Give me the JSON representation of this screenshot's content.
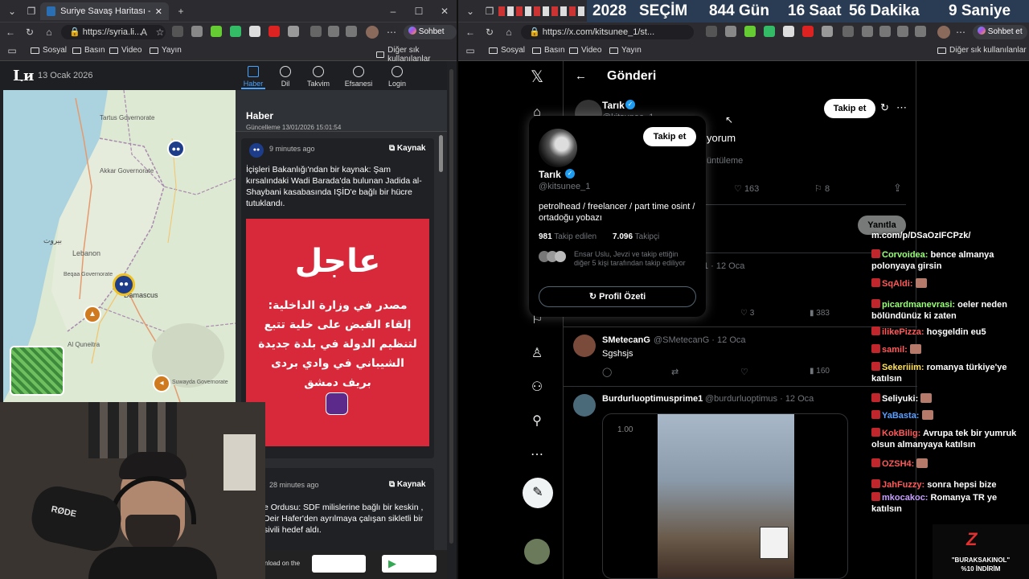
{
  "left_browser": {
    "tab_title": "Suriye Savaş Haritası - Son Dakika",
    "url": "https://syria.li...",
    "favorites": [
      "Sosyal",
      "Basın",
      "Video",
      "Yayın"
    ],
    "other_favorites": "Diğer sık kullanılanlar",
    "copilot": "Sohbet et"
  },
  "liveuamap": {
    "date": "13 Ocak 2026",
    "nav": [
      "Haber",
      "Dil",
      "Takvim",
      "Efsanesi",
      "Login"
    ],
    "panel_title": "Haber",
    "updated": "Güncelleme 13/01/2026 15:01:54",
    "item1_time": "9 minutes ago",
    "item1_source": "Kaynak",
    "item1_text": "İçişleri Bakanlığı'ndan bir kaynak: Şam kırsalındaki Wadi Barada'da bulunan Jadida al-Shaybani kasabasında IŞİD'e bağlı bir hücre tutuklandı.",
    "image_headline": "عاجل",
    "image_body": "مصدر في وزارة الداخلية: إلقاء القبض على خلية تتبع لتنظيم الدولة في بلدة جديدة الشيباني في وادي بردى بريف دمشق",
    "item2_time": "28 minutes ago",
    "item2_source": "Kaynak",
    "item2_text": "e Ordusu: SDF milislerine bağlı bir keskin , Deir Hafer'den ayrılmaya çalışan sikletli bir sivili hedef aldı.",
    "download_text": "nload on the",
    "map_labels": [
      "Tartus Governorate",
      "Akkar Governorate",
      "Lebanon",
      "Beqaa Governorate",
      "Damascus",
      "Al Quneitra",
      "Suwayda Governorate",
      "بيروت"
    ]
  },
  "right_browser": {
    "url": "https://x.com/kitsunee_1/st...",
    "favorites": [
      "Sosyal",
      "Basın",
      "Video",
      "Yayın"
    ],
    "other_favorites": "Diğer sık kullanılanlar",
    "copilot": "Sohbet et"
  },
  "countdown": {
    "year": "2028",
    "label": "SEÇİM",
    "days": "844 Gün",
    "hours": "16 Saat",
    "minutes": "56 Dakika",
    "seconds": "9 Saniye"
  },
  "x": {
    "header_title": "Gönderi",
    "author_name": "Tarık",
    "author_handle": "@kitsunee_1",
    "follow_label": "Takip et",
    "post_text_fragment": "yorum",
    "views_fragment": "üntüleme",
    "likes": "163",
    "bookmarks": "8",
    "reply_button": "Yanıtla",
    "hover_card": {
      "name": "Tarık",
      "handle": "@kitsunee_1",
      "follow_label": "Takip et",
      "bio": "petrolhead / freelancer / part time osint / ortadoğu yobazı",
      "following_count": "981",
      "following_label": "Takip edilen",
      "followers_count": "7.096",
      "followers_label": "Takipçi",
      "mutuals": "Ensar Uslu, Jevzi ve takip ettiğin diğer 5 kişi tarafından takip ediliyor",
      "summary_button": "Profil Özeti"
    },
    "reply1_date": "1 · 12 Oca",
    "reply1_likes": "3",
    "reply1_views": "383",
    "reply2_name": "SMetecanG",
    "reply2_handle": "@SMetecanG · 12 Oca",
    "reply2_text": "Sgshsjs",
    "reply2_views": "160",
    "reply3_name": "Burdurluoptimusprime1",
    "reply3_handle": "@burdurluoptimus · 12 Oca",
    "video_label": "1.00"
  },
  "chat": [
    {
      "user": "",
      "msg": "m.com/p/DSaOzIFCPzk/",
      "color": "#ffffff"
    },
    {
      "user": "Corvoidea:",
      "msg": "bence almanya polonyaya girsin",
      "color": "#9bff7a"
    },
    {
      "user": "SqAldi:",
      "msg": "",
      "color": "#ff5a5a"
    },
    {
      "user": "picardmanevrasi:",
      "msg": "oeler neden bölündünüz ki zaten",
      "color": "#9bff7a"
    },
    {
      "user": "ilikePizza:",
      "msg": "hoşgeldin eu5",
      "color": "#ff5a5a"
    },
    {
      "user": "samil:",
      "msg": "",
      "color": "#ff5a5a"
    },
    {
      "user": "Sekeriiim:",
      "msg": "romanya türkiye'ye katılsın",
      "color": "#ffe15a"
    },
    {
      "user": "Seliyuki:",
      "msg": "",
      "color": "#ffffff"
    },
    {
      "user": "YaBasta:",
      "msg": "",
      "color": "#5aa0ff"
    },
    {
      "user": "KokBilig:",
      "msg": "Avrupa tek bir yumruk olsun almanyaya katılsın",
      "color": "#ff5a5a"
    },
    {
      "user": "OZSH4:",
      "msg": "",
      "color": "#ff5a5a"
    },
    {
      "user": "JahFuzzy:",
      "msg": "sonra hepsi bize",
      "color": "#ff5a5a"
    },
    {
      "user": "mkocakoc:",
      "msg": "Romanya TR ye katılsın",
      "color": "#c8a0ff"
    }
  ],
  "promo": {
    "logo": "Z",
    "code": "\"BURAKSAKINOL\"",
    "discount": "%10 İNDİRİM"
  },
  "webcam": {
    "mic_brand": "RØDE"
  }
}
